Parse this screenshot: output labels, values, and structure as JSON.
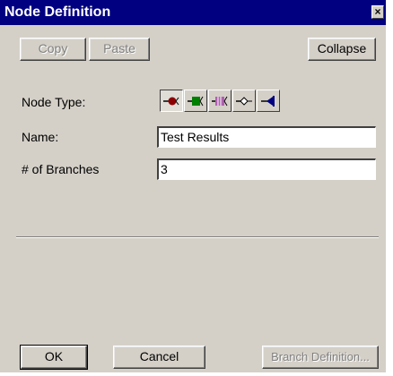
{
  "window": {
    "title": "Node Definition",
    "close_glyph": "×"
  },
  "toolbar": {
    "copy_label": "Copy",
    "paste_label": "Paste",
    "collapse_label": "Collapse"
  },
  "form": {
    "node_type_label": "Node Type:",
    "name_label": "Name:",
    "name_value": "Test Results",
    "branches_label": "# of Branches",
    "branches_value": "3"
  },
  "node_types": [
    {
      "icon": "chance-node-icon",
      "color": "#8b0000",
      "selected": true
    },
    {
      "icon": "decision-node-icon",
      "color": "#008000",
      "selected": false
    },
    {
      "icon": "markov-node-icon",
      "color": "#800080",
      "selected": false
    },
    {
      "icon": "logic-node-icon",
      "color": "#000000",
      "selected": false
    },
    {
      "icon": "terminal-node-icon",
      "color": "#000080",
      "selected": false
    }
  ],
  "footer": {
    "ok_label": "OK",
    "cancel_label": "Cancel",
    "branch_definition_label": "Branch Definition..."
  },
  "colors": {
    "title_bar": "#000080",
    "dialog_bg": "#d4d0c8"
  }
}
